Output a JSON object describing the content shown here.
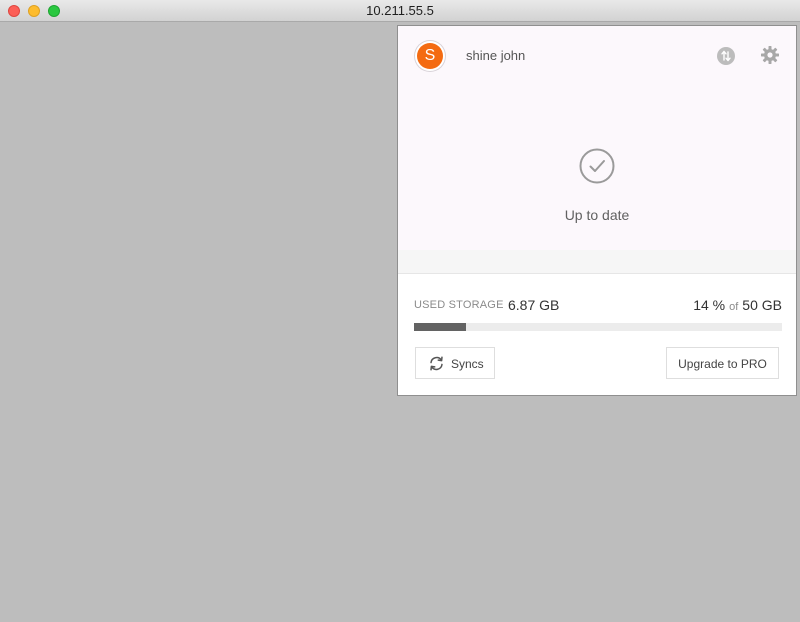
{
  "window": {
    "title": "10.211.55.5"
  },
  "header": {
    "avatar_initial": "S",
    "username": "shine john",
    "sync_icon": "transfer-arrows-icon",
    "settings_icon": "gear-icon"
  },
  "status": {
    "icon": "check-circle-icon",
    "text": "Up to date"
  },
  "storage": {
    "label": "USED STORAGE",
    "used": "6.87 GB",
    "percent_text": "14 %",
    "of_text": "of",
    "total": "50 GB",
    "used_fraction": 0.14
  },
  "buttons": {
    "syncs_label": "Syncs",
    "upgrade_label": "Upgrade to PRO"
  },
  "colors": {
    "avatar": "#f46b12",
    "progress_fill": "#636363",
    "desktop_bg": "#bdbdbd"
  }
}
